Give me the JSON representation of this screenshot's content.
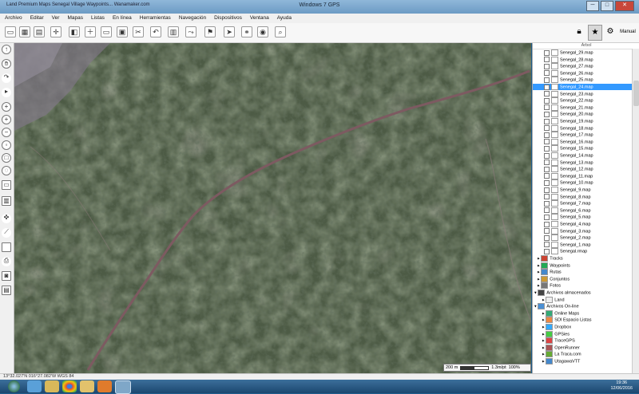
{
  "window": {
    "title": "Windows 7 GPS",
    "subtitle": "Land Premium Maps Senegal Village Waypoints... Wanamaker.com",
    "controls": {
      "minimize": "─",
      "maximize": "□",
      "close": "✕"
    }
  },
  "menu": [
    "Archivo",
    "Editar",
    "Ver",
    "Mapas",
    "Listas",
    "En línea",
    "Herramientas",
    "Navegación",
    "Dispositivos",
    "Ventana",
    "Ayuda"
  ],
  "toolbar": {
    "right_label": "Manual",
    "icons": [
      "save-icon",
      "image-icon",
      "clipboard-icon",
      "crosshair-icon",
      "layer-icon",
      "open-icon",
      "disk-icon",
      "cut-icon",
      "undo-icon",
      "map-icon",
      "route-icon",
      "flag-icon",
      "send-icon",
      "link-icon",
      "car-icon",
      "search-icon"
    ]
  },
  "left_tools": [
    "north-icon",
    "hand-icon",
    "rotate-icon",
    "pointer-icon",
    "crosshair-icon",
    "zoom-in-icon",
    "zoom-out-icon",
    "zoom-fit-icon",
    "zoom-area-icon",
    "zoom-prev-icon",
    "measure-icon",
    "trash-icon",
    "waypoint-icon",
    "ruler-icon",
    "square-icon",
    "print-icon",
    "camera-icon",
    "layers-icon"
  ],
  "map": {
    "scale_label": "200 m",
    "scale_value": "1.3m/pt",
    "zoom": "100%"
  },
  "panel": {
    "title": "Árbol",
    "maps": [
      "Senegal_29.map",
      "Senegal_28.map",
      "Senegal_27.map",
      "Senegal_26.map",
      "Senegal_25.map",
      "Senegal_24.map",
      "Senegal_23.map",
      "Senegal_22.map",
      "Senegal_21.map",
      "Senegal_20.map",
      "Senegal_19.map",
      "Senegal_18.map",
      "Senegal_17.map",
      "Senegal_16.map",
      "Senegal_15.map",
      "Senegal_14.map",
      "Senegal_13.map",
      "Senegal_12.map",
      "Senegal_11.map",
      "Senegal_10.map",
      "Senegal_9.map",
      "Senegal_8.map",
      "Senegal_7.map",
      "Senegal_6.map",
      "Senegal_5.map",
      "Senegal_4.map",
      "Senegal_3.map",
      "Senegal_2.map",
      "Senegal_1.map",
      "Senegal.rmap"
    ],
    "selected_index": 5,
    "groups": [
      "Tracks",
      "Waypoints",
      "Rutas",
      "Conjuntos",
      "Fotos"
    ],
    "stored_label": "Archivos almacenados",
    "stored_items": [
      "Land"
    ],
    "online_label": "Archivos On-line",
    "online_items": [
      "Online Maps",
      "SDI Espacio Listas",
      "Dropbox",
      "GPSies",
      "TraceGPS",
      "OpenRunner",
      "La Traca.com",
      "UtagawaVTT"
    ]
  },
  "status": {
    "coords": "13°32.027'N 016°27.082'W  WGS 84"
  },
  "taskbar": {
    "time": "19:36",
    "date": "12/06/2016",
    "apps": [
      "start-icon",
      "ie-icon",
      "explorer-icon",
      "chrome-icon",
      "folder-icon",
      "media-icon",
      "gps-icon"
    ]
  },
  "colors": {
    "selection": "#3399ff",
    "road": "#7d5a61",
    "taskbar": "#1c476f"
  }
}
